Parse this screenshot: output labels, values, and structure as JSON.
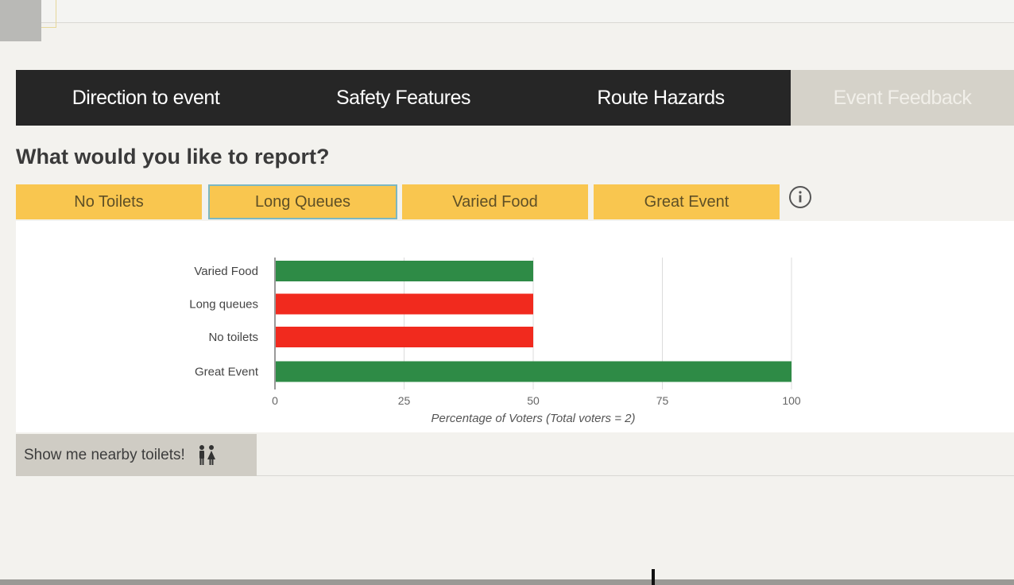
{
  "tabs": [
    {
      "label": "Direction to event",
      "active": false
    },
    {
      "label": "Safety Features",
      "active": false
    },
    {
      "label": "Route Hazards",
      "active": false
    },
    {
      "label": "Event Feedback",
      "active": true
    }
  ],
  "report": {
    "question": "What would you like to report?",
    "options": [
      {
        "label": "No Toilets",
        "selected": false
      },
      {
        "label": "Long Queues",
        "selected": true
      },
      {
        "label": "Varied Food",
        "selected": false
      },
      {
        "label": "Great Event",
        "selected": false
      }
    ],
    "info_icon": "info-icon"
  },
  "toilets_button": {
    "label": "Show me nearby toilets!",
    "icon": "toilets-icon"
  },
  "colors": {
    "positive": "#2e8b46",
    "negative": "#f12a1e",
    "option_bg": "#f9c64f",
    "tab_bg": "#262626",
    "tab_active_bg": "#d5d2c9"
  },
  "chart_data": {
    "type": "bar",
    "orientation": "horizontal",
    "categories": [
      "Varied Food",
      "Long queues",
      "No toilets",
      "Great Event"
    ],
    "values": [
      50,
      50,
      50,
      100
    ],
    "bar_colors": [
      "#2e8b46",
      "#f12a1e",
      "#f12a1e",
      "#2e8b46"
    ],
    "xlabel": "Percentage of Voters (Total voters = 2)",
    "ylabel": "",
    "xlim": [
      0,
      100
    ],
    "xticks": [
      "0",
      "25",
      "50",
      "75",
      "100"
    ],
    "grid": true
  }
}
